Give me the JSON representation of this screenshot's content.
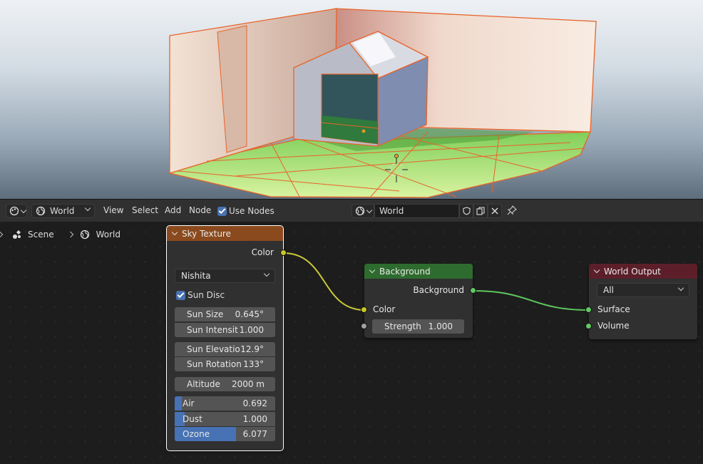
{
  "header": {
    "editor_type_icon": "node-editor-icon",
    "shader_type": "World",
    "menus": [
      "View",
      "Select",
      "Add",
      "Node"
    ],
    "use_nodes_label": "Use Nodes",
    "use_nodes_checked": true,
    "datablock_name": "World"
  },
  "breadcrumb": {
    "items": [
      "Scene",
      "World"
    ]
  },
  "nodes": {
    "sky_texture": {
      "title": "Sky Texture",
      "header_color": "#8a4a1d",
      "output_color": "Color",
      "sky_type": "Nishita",
      "sun_disc_label": "Sun Disc",
      "sun_disc_checked": true,
      "sun_size_label": "Sun Size",
      "sun_size_value": "0.645°",
      "sun_intensity_label": "Sun Intensit",
      "sun_intensity_value": "1.000",
      "sun_elevation_label": "Sun Elevatio",
      "sun_elevation_value": "12.9°",
      "sun_rotation_label": "Sun Rotation",
      "sun_rotation_value": "133°",
      "altitude_label": "Altitude",
      "altitude_value": "2000 m",
      "air_label": "Air",
      "air_value": "0.692",
      "air_fraction": 0.069,
      "dust_label": "Dust",
      "dust_value": "1.000",
      "dust_fraction": 0.1,
      "ozone_label": "Ozone",
      "ozone_value": "6.077",
      "ozone_fraction": 0.608
    },
    "background": {
      "title": "Background",
      "header_color": "#2e6b2e",
      "output_background": "Background",
      "input_color": "Color",
      "strength_label": "Strength",
      "strength_value": "1.000"
    },
    "world_output": {
      "title": "World Output",
      "header_color": "#5c1f2a",
      "target": "All",
      "input_surface": "Surface",
      "input_volume": "Volume"
    }
  },
  "colors": {
    "socket_color": "#c7c729",
    "socket_shader": "#63c763",
    "socket_float": "#a1a1a1",
    "accent": "#4772b3",
    "selection_outline": "#ff8c2a"
  }
}
